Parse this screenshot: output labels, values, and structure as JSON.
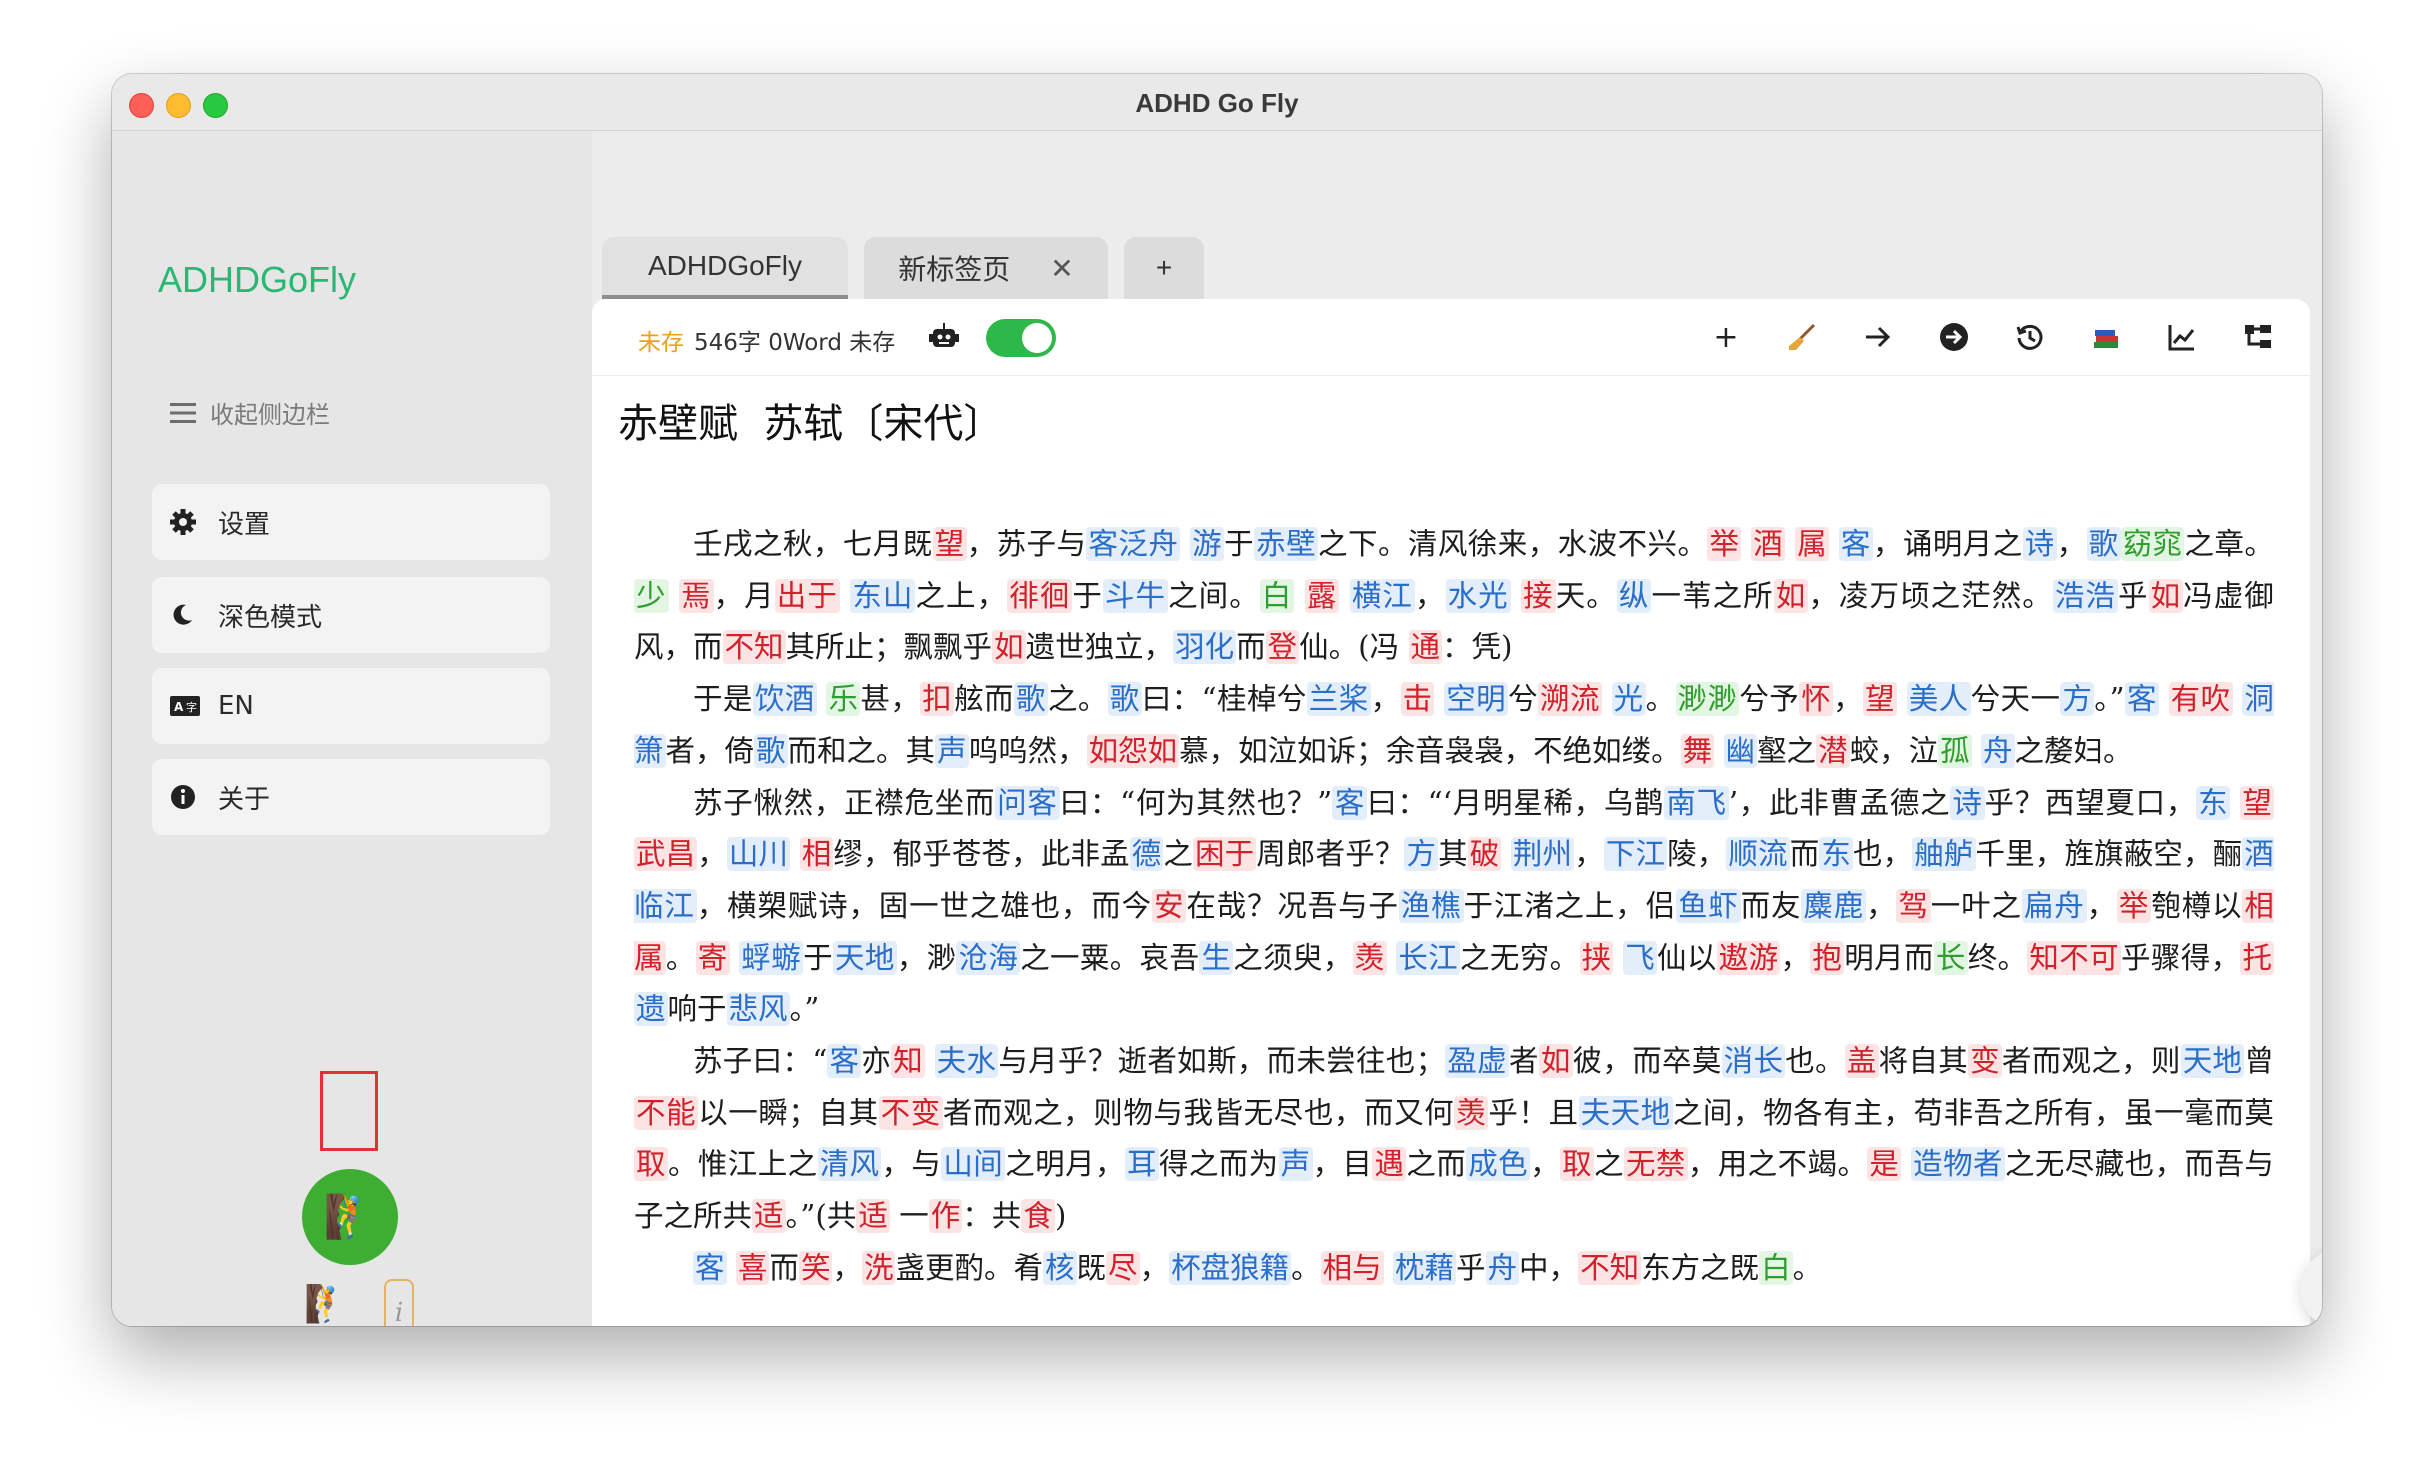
{
  "window": {
    "title": "ADHD Go Fly"
  },
  "sidebar": {
    "brand": "ADHDGoFly",
    "collapse_label": "收起侧边栏",
    "items": [
      {
        "label": "设置",
        "icon": "gear-icon"
      },
      {
        "label": "深色模式",
        "icon": "moon-icon"
      },
      {
        "label": "EN",
        "icon": "language-icon"
      },
      {
        "label": "关于",
        "icon": "info-circle-icon"
      }
    ],
    "info_button": "i"
  },
  "tabs": [
    {
      "label": "ADHDGoFly",
      "active": true
    },
    {
      "label": "新标签页",
      "close": "✕"
    },
    {
      "label": "+"
    }
  ],
  "toolbar": {
    "unsaved_tag": "未存",
    "stats": "546字 0Word 未存",
    "toggle_on": true,
    "tools": [
      "+",
      "broom-icon",
      "arrow-right-icon",
      "circle-arrow-icon",
      "history-icon",
      "books-icon",
      "chart-icon",
      "tree-icon"
    ]
  },
  "document": {
    "title": "赤壁赋  苏轼〔宋代〕"
  },
  "colors": {
    "accent_green": "#2bb673",
    "toggle_green": "#2fb84a",
    "highlight_red": "#d1212a",
    "highlight_blue": "#2a6ec9",
    "highlight_green": "#2f9e2f"
  }
}
